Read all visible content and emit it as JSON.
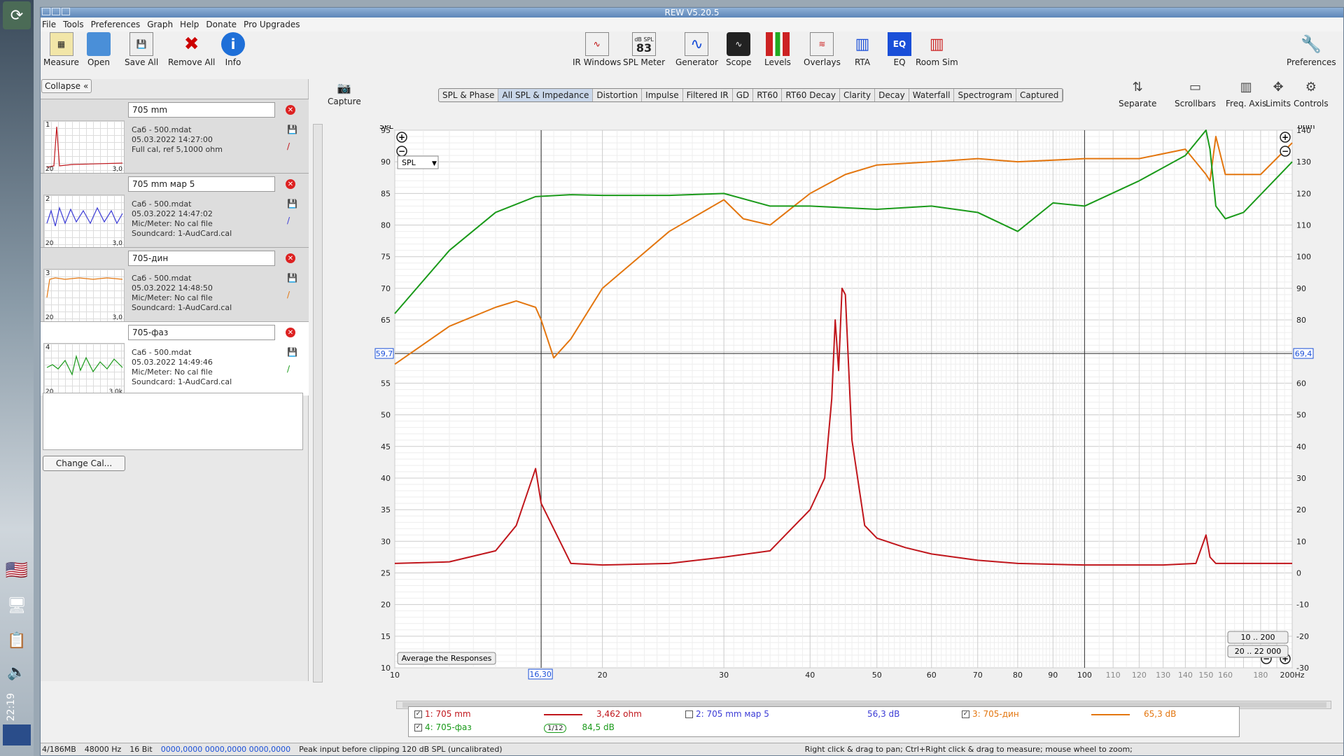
{
  "window": {
    "title": "REW V5.20.5"
  },
  "taskbar": {
    "clock": "22:19"
  },
  "menu": [
    "File",
    "Tools",
    "Preferences",
    "Graph",
    "Help",
    "Donate",
    "Pro Upgrades"
  ],
  "toolbar_left": [
    {
      "label": "Measure",
      "icon": "measure-icon"
    },
    {
      "label": "Open",
      "icon": "folder-icon"
    },
    {
      "label": "Save All",
      "icon": "save-icon"
    },
    {
      "label": "Remove All",
      "icon": "remove-all-icon"
    },
    {
      "label": "Info",
      "icon": "info-icon"
    }
  ],
  "toolbar_center": [
    {
      "label": "IR Windows",
      "icon": "ir-windows-icon"
    },
    {
      "label": "SPL Meter",
      "icon": "spl-meter-icon",
      "badge": "83",
      "badge_top": "dB SPL"
    },
    {
      "label": "Generator",
      "icon": "generator-icon"
    },
    {
      "label": "Scope",
      "icon": "scope-icon"
    },
    {
      "label": "Levels",
      "icon": "levels-icon"
    },
    {
      "label": "Overlays",
      "icon": "overlays-icon"
    },
    {
      "label": "RTA",
      "icon": "rta-icon"
    },
    {
      "label": "EQ",
      "icon": "eq-icon"
    },
    {
      "label": "Room Sim",
      "icon": "room-sim-icon"
    }
  ],
  "toolbar_right": {
    "label": "Preferences",
    "icon": "wrench-icon"
  },
  "left_panel": {
    "collapse": "Collapse",
    "change_cal": "Change Cal...",
    "measurements": [
      {
        "num": "1",
        "name": "705 mm",
        "file": "Саб - 500.mdat",
        "date": "05.03.2022 14:27:00",
        "line3": "Full cal, ref 5,1000 ohm",
        "line4": "",
        "axis_l": "20",
        "axis_r": "3,0",
        "color": "#c0161c"
      },
      {
        "num": "2",
        "name": "705 mm мар 5",
        "file": "Саб - 500.mdat",
        "date": "05.03.2022 14:47:02",
        "line3": "Mic/Meter: No cal file",
        "line4": "Soundcard: 1-AudCard.cal",
        "axis_l": "20",
        "axis_r": "3,0",
        "color": "#3b3bd6"
      },
      {
        "num": "3",
        "name": "705-дин",
        "file": "Саб - 500.mdat",
        "date": "05.03.2022 14:48:50",
        "line3": "Mic/Meter: No cal file",
        "line4": "Soundcard: 1-AudCard.cal",
        "axis_l": "20",
        "axis_r": "3,0",
        "color": "#e3760f"
      },
      {
        "num": "4",
        "name": "705-фаз",
        "file": "Саб - 500.mdat",
        "date": "05.03.2022 14:49:46",
        "line3": "Mic/Meter: No cal file",
        "line4": "Soundcard: 1-AudCard.cal",
        "axis_l": "20",
        "axis_r": "3,0k",
        "color": "#1a9a1a"
      }
    ]
  },
  "capture": "Capture",
  "graph_tabs": [
    "SPL & Phase",
    "All SPL & Impedance",
    "Distortion",
    "Impulse",
    "Filtered IR",
    "GD",
    "RT60",
    "RT60 Decay",
    "Clarity",
    "Decay",
    "Waterfall",
    "Spectrogram",
    "Captured"
  ],
  "graph_tab_active": 1,
  "right_tools": [
    "Separate",
    "Scrollbars",
    "Freq. Axis",
    "Limits",
    "Controls"
  ],
  "graph": {
    "y_left_label": "SPL",
    "y_right_label": "ohm",
    "x_unit": "Hz",
    "spl_select": "SPL",
    "cursor_left": "59,7",
    "cursor_right": "69,4",
    "cursor_x": "16,30",
    "average_btn": "Average the Responses",
    "range_btn1": "10 .. 200",
    "range_btn2": "20 .. 22 000",
    "y_left_ticks": [
      "95",
      "90",
      "85",
      "80",
      "75",
      "70",
      "65",
      "60",
      "55",
      "50",
      "45",
      "40",
      "35",
      "30",
      "25",
      "20",
      "15",
      "10"
    ],
    "y_right_ticks": [
      "140",
      "130",
      "120",
      "110",
      "100",
      "90",
      "80",
      "70",
      "60",
      "50",
      "40",
      "30",
      "20",
      "10",
      "0",
      "-10",
      "-20",
      "-30"
    ],
    "x_ticks": [
      "10",
      "20",
      "30",
      "40",
      "50",
      "60",
      "70",
      "80",
      "90",
      "100",
      "110",
      "120",
      "130",
      "140",
      "150",
      "160",
      "180",
      "200Hz"
    ]
  },
  "chart_data": {
    "type": "line",
    "x_scale": "log",
    "xlim": [
      10,
      200
    ],
    "ylim": [
      10,
      95
    ],
    "y2lim": [
      -30,
      140
    ],
    "series": [
      {
        "name": "705 mm",
        "color": "#c0161c",
        "axis": "ohm",
        "x": [
          10,
          12,
          14,
          15,
          16,
          16.3,
          18,
          20,
          25,
          30,
          35,
          40,
          42,
          43,
          43.5,
          44,
          44.5,
          45,
          46,
          48,
          50,
          55,
          60,
          70,
          80,
          100,
          130,
          145,
          150,
          152,
          155,
          160,
          200
        ],
        "y": [
          3,
          3.5,
          7,
          15,
          33,
          22,
          3,
          2.5,
          3,
          5,
          7,
          20,
          30,
          55,
          80,
          64,
          90,
          88,
          42,
          15,
          11,
          8,
          6,
          4,
          3,
          2.5,
          2.5,
          3,
          12,
          5,
          3,
          3,
          3
        ]
      },
      {
        "name": "705-дин",
        "color": "#e3760f",
        "axis": "spl",
        "x": [
          10,
          12,
          14,
          15,
          16,
          16.3,
          17,
          18,
          20,
          25,
          30,
          32,
          35,
          40,
          45,
          50,
          60,
          70,
          80,
          100,
          120,
          140,
          150,
          152,
          155,
          160,
          180,
          200
        ],
        "y": [
          58,
          64,
          67,
          68,
          67,
          65,
          59,
          62,
          70,
          79,
          84,
          81,
          80,
          85,
          88,
          89.5,
          90,
          90.5,
          90,
          90.5,
          90.5,
          92,
          88,
          87,
          94,
          88,
          88,
          93
        ]
      },
      {
        "name": "705-фаз",
        "color": "#1a9a1a",
        "axis": "spl",
        "x": [
          10,
          12,
          14,
          16,
          18,
          20,
          25,
          30,
          35,
          40,
          50,
          60,
          70,
          80,
          90,
          100,
          120,
          140,
          150,
          152,
          155,
          160,
          170,
          200
        ],
        "y": [
          66,
          76,
          82,
          84.5,
          84.8,
          84.7,
          84.7,
          85,
          83,
          83,
          82.5,
          83,
          82,
          79,
          83.5,
          83,
          87,
          91,
          95,
          92,
          83,
          81,
          82,
          90
        ]
      }
    ]
  },
  "legend": {
    "items": [
      {
        "checked": true,
        "label": "1: 705 mm",
        "value": "3,462 ohm",
        "color": "#c0161c"
      },
      {
        "checked": false,
        "label": "2: 705 mm мар 5",
        "value": "56,3 dB",
        "color": "#3b3bd6"
      },
      {
        "checked": true,
        "label": "3: 705-дин",
        "value": "65,3 dB",
        "color": "#e3760f"
      },
      {
        "checked": true,
        "label": "4: 705-фаз",
        "value": "84,5 dB",
        "color": "#1a9a1a",
        "smooth": "1/12"
      }
    ]
  },
  "status": {
    "mem": "4/186MB",
    "rate": "48000 Hz",
    "bits": "16 Bit",
    "levels": "0000,0000  0000,0000  0000,0000",
    "peak": "Peak input before clipping 120 dB SPL (uncalibrated)",
    "hint": "Right click & drag to pan; Ctrl+Right click & drag to measure; mouse wheel to zoom;"
  }
}
